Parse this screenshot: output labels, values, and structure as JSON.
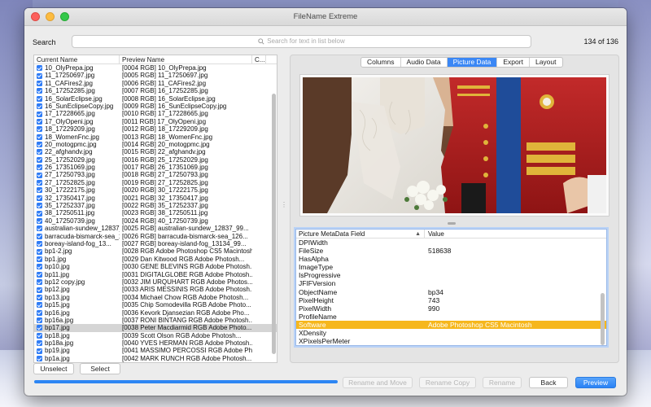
{
  "window": {
    "title": "FileName Extreme"
  },
  "search": {
    "label": "Search",
    "placeholder": "Search for text in list below",
    "count": "134 of 136"
  },
  "file_table": {
    "columns": [
      "Current Name",
      "Preview Name",
      "C..."
    ],
    "rows": [
      {
        "current": "10_OlyPrepa.jpg",
        "preview": "[0004 RGB] 10_OlyPrepa.jpg",
        "checked": true
      },
      {
        "current": "11_17250697.jpg",
        "preview": "[0005 RGB] 11_17250697.jpg",
        "checked": true
      },
      {
        "current": "11_CAFires2.jpg",
        "preview": "[0006 RGB] 11_CAFires2.jpg",
        "checked": true
      },
      {
        "current": "16_17252285.jpg",
        "preview": "[0007 RGB] 16_17252285.jpg",
        "checked": true
      },
      {
        "current": "16_SolarEclipse.jpg",
        "preview": "[0008 RGB] 16_SolarEclipse.jpg",
        "checked": true
      },
      {
        "current": "16_SunEclipseCopy.jpg",
        "preview": "[0009 RGB] 16_SunEclipseCopy.jpg",
        "checked": true
      },
      {
        "current": "17_17228665.jpg",
        "preview": "[0010 RGB] 17_17228665.jpg",
        "checked": true
      },
      {
        "current": "17_OlyOpeni.jpg",
        "preview": "[0011 RGB] 17_OlyOpeni.jpg",
        "checked": true
      },
      {
        "current": "18_17229209.jpg",
        "preview": "[0012 RGB] 18_17229209.jpg",
        "checked": true
      },
      {
        "current": "18_WomenFnc.jpg",
        "preview": "[0013 RGB] 18_WomenFnc.jpg",
        "checked": true
      },
      {
        "current": "20_motogpmc.jpg",
        "preview": "[0014 RGB] 20_motogpmc.jpg",
        "checked": true
      },
      {
        "current": "22_afghandv.jpg",
        "preview": "[0015 RGB] 22_afghandv.jpg",
        "checked": true
      },
      {
        "current": "25_17252029.jpg",
        "preview": "[0016 RGB] 25_17252029.jpg",
        "checked": true
      },
      {
        "current": "26_17351069.jpg",
        "preview": "[0017 RGB] 26_17351069.jpg",
        "checked": true
      },
      {
        "current": "27_17250793.jpg",
        "preview": "[0018 RGB] 27_17250793.jpg",
        "checked": true
      },
      {
        "current": "27_17252825.jpg",
        "preview": "[0019 RGB] 27_17252825.jpg",
        "checked": true
      },
      {
        "current": "30_17222175.jpg",
        "preview": "[0020 RGB] 30_17222175.jpg",
        "checked": true
      },
      {
        "current": "32_17350417.jpg",
        "preview": "[0021 RGB] 32_17350417.jpg",
        "checked": true
      },
      {
        "current": "35_17252337.jpg",
        "preview": "[0022 RGB] 35_17252337.jpg",
        "checked": true
      },
      {
        "current": "38_17250511.jpg",
        "preview": "[0023 RGB] 38_17250511.jpg",
        "checked": true
      },
      {
        "current": "40_17250739.jpg",
        "preview": "[0024 RGB] 40_17250739.jpg",
        "checked": true
      },
      {
        "current": "australian-sundew_12837_99...",
        "preview": "[0025 RGB] australian-sundew_12837_99...",
        "checked": true
      },
      {
        "current": "barracuda-bismarck-sea_126...",
        "preview": "[0026 RGB] barracuda-bismarck-sea_126...",
        "checked": true
      },
      {
        "current": "boreay-island-fog_13...",
        "preview": "[0027 RGB] boreay-island-fog_13134_99...",
        "checked": true
      },
      {
        "current": "bp1-2.jpg",
        "preview": "[0028 RGB Adobe Photoshop CS5 Macintosh",
        "checked": true
      },
      {
        "current": "bp1.jpg",
        "preview": "[0029 Dan Kitwood RGB Adobe Photosh...",
        "checked": true
      },
      {
        "current": "bp10.jpg",
        "preview": "[0030 GENE BLEVINS RGB Adobe Photosh...",
        "checked": true
      },
      {
        "current": "bp11.jpg",
        "preview": "[0031 DIGITALGLOBE RGB Adobe Photosh...",
        "checked": true
      },
      {
        "current": "bp12 copy.jpg",
        "preview": "[0032 JIM URQUHART RGB Adobe Photos...",
        "checked": true
      },
      {
        "current": "bp12.jpg",
        "preview": "[0033 ARIS MESSINIS RGB Adobe Photosh...",
        "checked": true
      },
      {
        "current": "bp13.jpg",
        "preview": "[0034 Michael Chow RGB Adobe Photosh...",
        "checked": true
      },
      {
        "current": "bp15.jpg",
        "preview": "[0035 Chip Somodevilla RGB Adobe Photo...",
        "checked": true
      },
      {
        "current": "bp16.jpg",
        "preview": "[0036 Kevork Djansezian RGB Adobe Pho...",
        "checked": true
      },
      {
        "current": "bp16a.jpg",
        "preview": "[0037 RONI BINTANG RGB Adobe Photosh...",
        "checked": true
      },
      {
        "current": "bp17.jpg",
        "preview": "[0038 Peter Macdiarmid RGB Adobe Photo...",
        "checked": true,
        "selected": true
      },
      {
        "current": "bp18.jpg",
        "preview": "[0039 Scott Olson RGB Adobe Photosh...",
        "checked": true
      },
      {
        "current": "bp18a.jpg",
        "preview": "[0040 YVES HERMAN RGB Adobe Photosh...",
        "checked": true
      },
      {
        "current": "bp19.jpg",
        "preview": "[0041 MASSIMO PERCOSSI RGB Adobe Ph...",
        "checked": true
      },
      {
        "current": "bp1a.jpg",
        "preview": "[0042 MARK RUNCH RGB Adobe Photosh...",
        "checked": true
      }
    ]
  },
  "buttons": {
    "unselect": "Unselect",
    "select": "Select",
    "rename_and_move": "Rename and Move",
    "rename_copy": "Rename Copy",
    "rename": "Rename",
    "back": "Back",
    "preview": "Preview"
  },
  "tabs": [
    {
      "label": "Columns",
      "active": false
    },
    {
      "label": "Audio Data",
      "active": false
    },
    {
      "label": "Picture Data",
      "active": true
    },
    {
      "label": "Export",
      "active": false
    },
    {
      "label": "Layout",
      "active": false
    }
  ],
  "metadata": {
    "columns": [
      "Picture MetaData Field",
      "Value"
    ],
    "rows": [
      {
        "field": "DPIWidth",
        "value": ""
      },
      {
        "field": "FileSize",
        "value": "518638"
      },
      {
        "field": "HasAlpha",
        "value": ""
      },
      {
        "field": "ImageType",
        "value": ""
      },
      {
        "field": "IsProgressive",
        "value": ""
      },
      {
        "field": "JFIFVersion",
        "value": ""
      },
      {
        "field": "ObjectName",
        "value": "bp34"
      },
      {
        "field": "PixelHeight",
        "value": "743"
      },
      {
        "field": "PixelWidth",
        "value": "990"
      },
      {
        "field": "ProfileName",
        "value": ""
      },
      {
        "field": "Software",
        "value": "Adobe Photoshop CS5 Macintosh",
        "highlight": true
      },
      {
        "field": "XDensity",
        "value": ""
      },
      {
        "field": "XPixelsPerMeter",
        "value": ""
      }
    ]
  },
  "progress": {
    "value": 1.0
  },
  "colors": {
    "accent": "#2f7cf6",
    "highlight_row": "#f6b71c",
    "tab_active": "#3a87f5"
  }
}
